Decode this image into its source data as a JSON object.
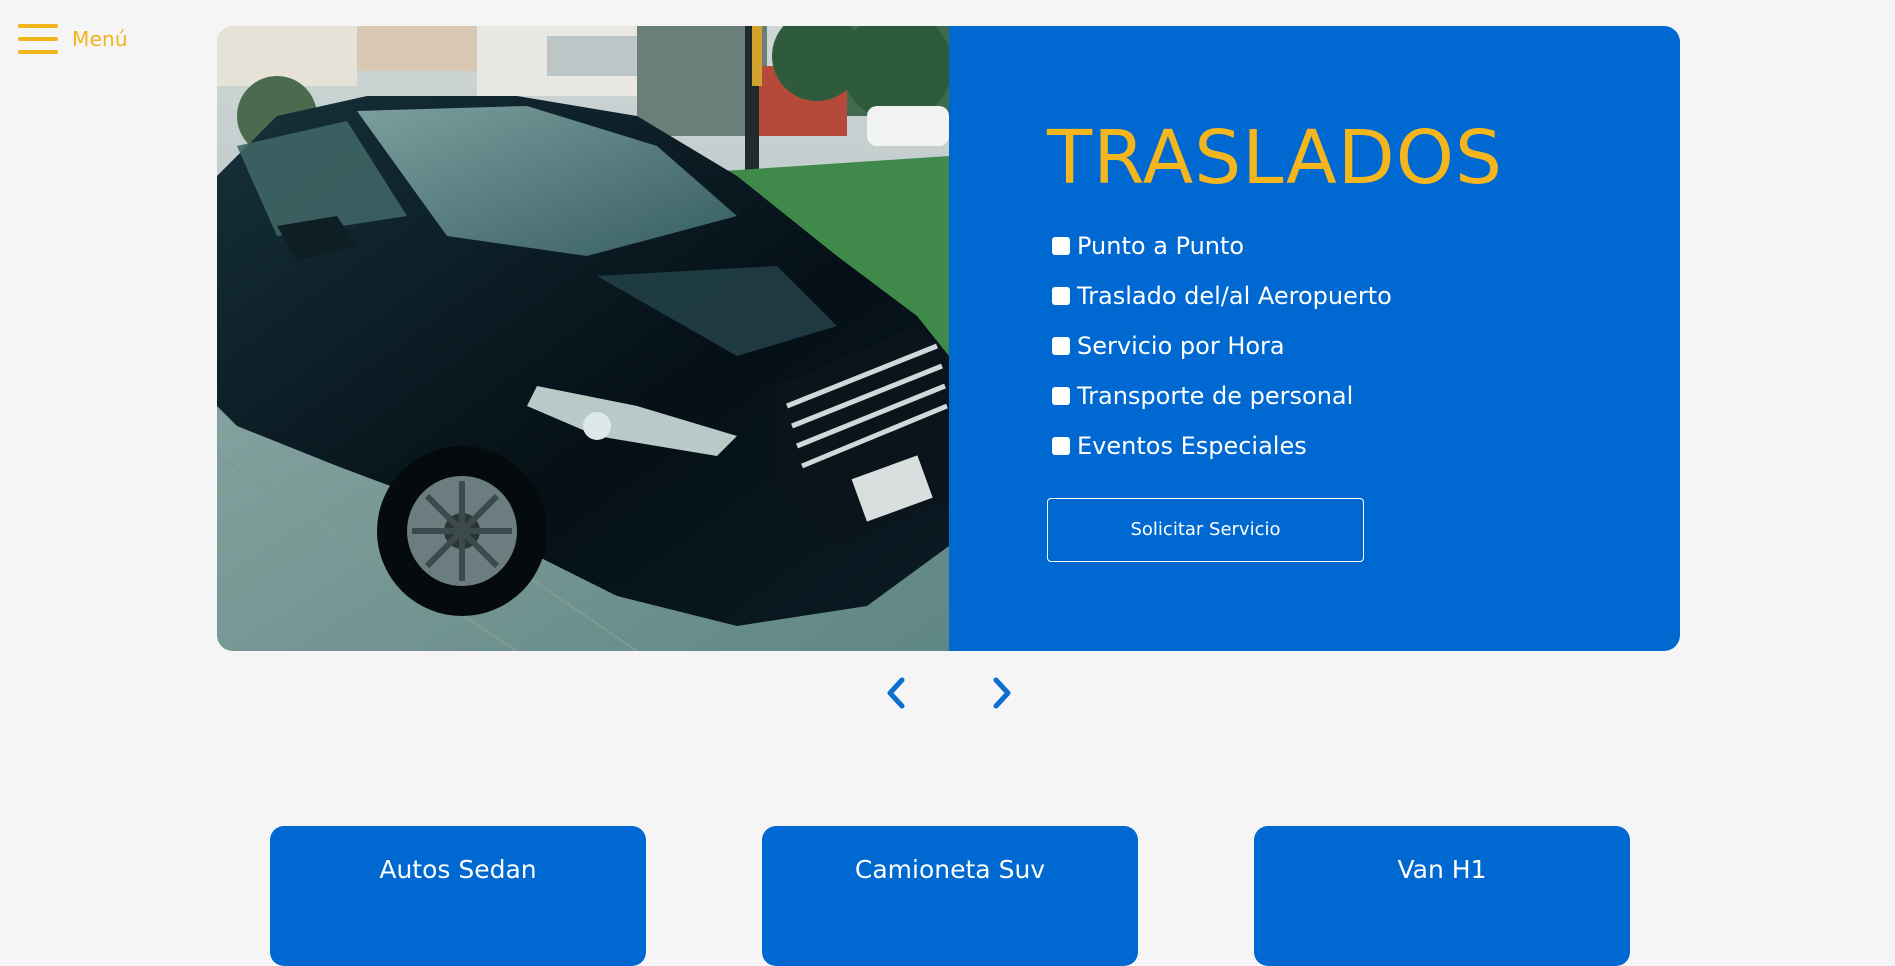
{
  "menu": {
    "label": "Menú"
  },
  "slide": {
    "title": "TRASLADOS",
    "image_description": "car-photo",
    "services": [
      "Punto a Punto",
      "Traslado del/al Aeropuerto",
      "Servicio por Hora",
      "Transporte de personal",
      "Eventos Especiales"
    ],
    "button_label": "Solicitar Servicio"
  },
  "controls": {
    "prev_icon": "chevron-left-icon",
    "next_icon": "chevron-right-icon"
  },
  "vehicles": [
    "Autos Sedan",
    "Camioneta Suv",
    "Van H1"
  ],
  "colors": {
    "accent": "#f2b41b",
    "primary": "#0068d1",
    "background": "#f5f5f5"
  }
}
